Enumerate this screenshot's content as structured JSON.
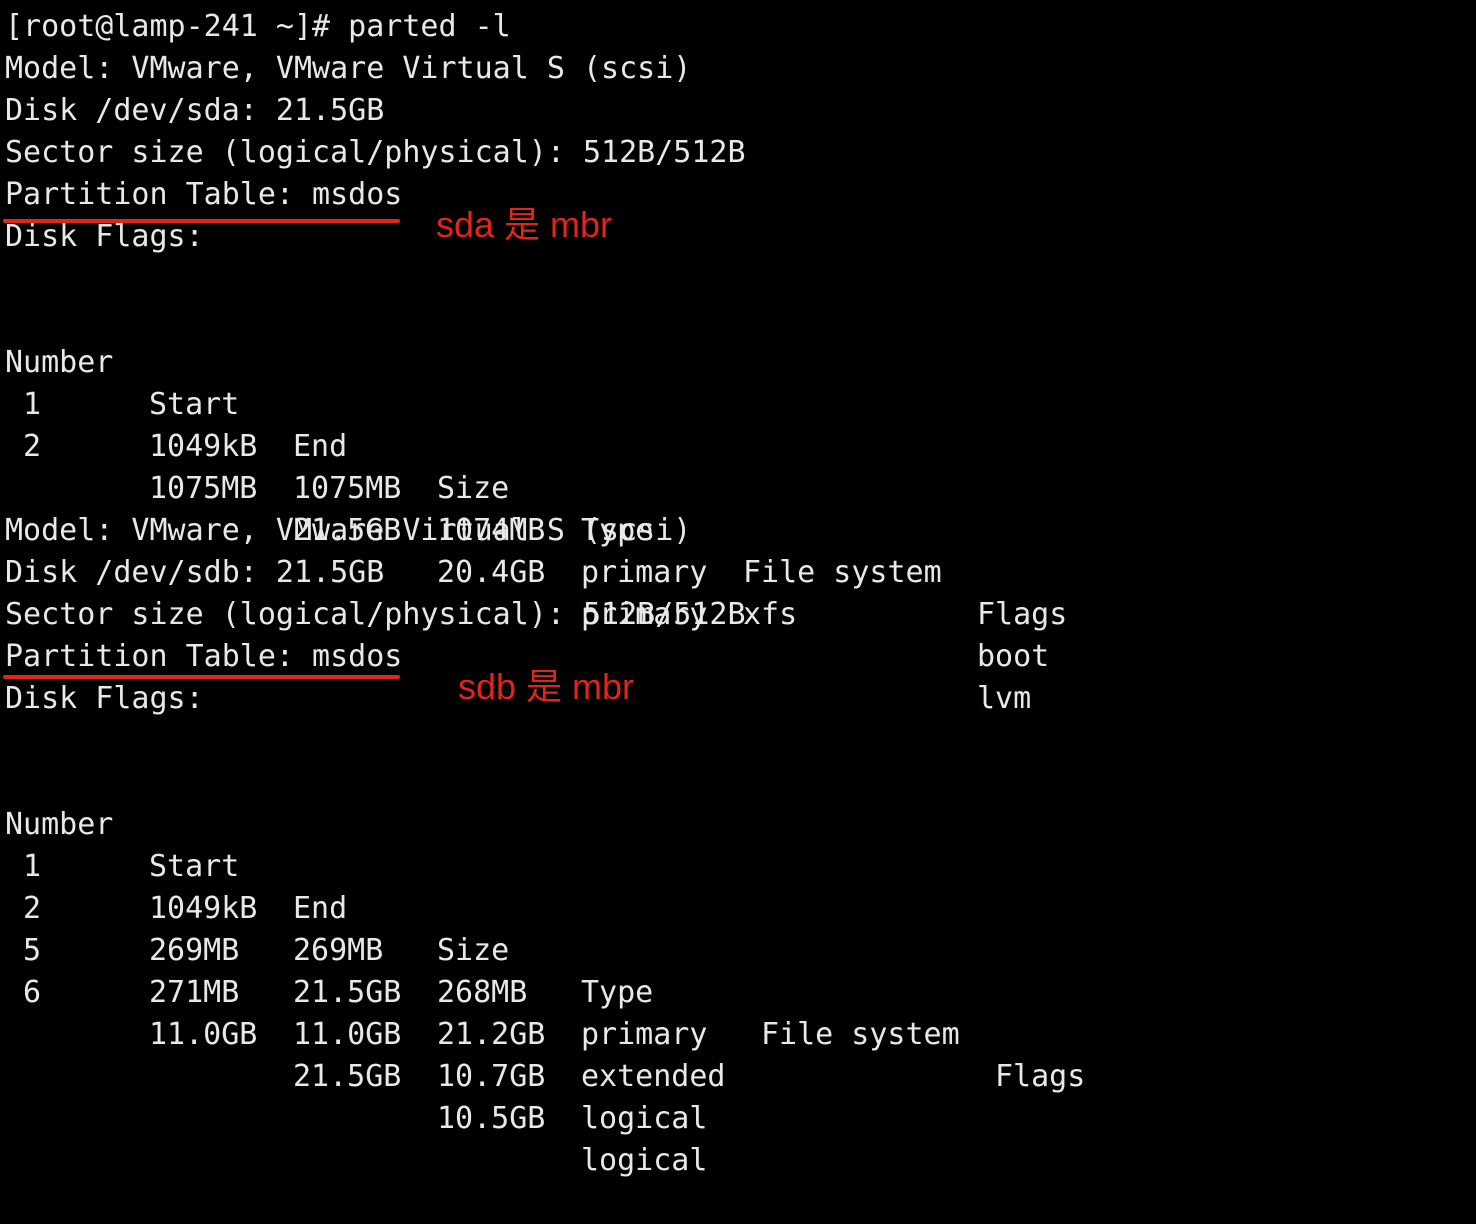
{
  "terminal": {
    "clipped_top_line": "[ ----- - - ----- - ]",
    "prompt": "[root@lamp-241 ~]# parted -l",
    "disks": [
      {
        "model": "Model: VMware, VMware Virtual S (scsi)",
        "disk": "Disk /dev/sda: 21.5GB",
        "sector_size": "Sector size (logical/physical): 512B/512B",
        "partition_table": "Partition Table: msdos",
        "disk_flags": "Disk Flags:",
        "annotation": "sda 是 mbr",
        "columns": [
          "Number",
          "Start",
          "End",
          "Size",
          "Type",
          "File system",
          "Flags"
        ],
        "rows": [
          [
            "1",
            "1049kB",
            "1075MB",
            "1074MB",
            "primary",
            "xfs",
            "boot"
          ],
          [
            "2",
            "1075MB",
            "21.5GB",
            "20.4GB",
            "primary",
            "",
            "lvm"
          ]
        ]
      },
      {
        "model": "Model: VMware, VMware Virtual S (scsi)",
        "disk": "Disk /dev/sdb: 21.5GB",
        "sector_size": "Sector size (logical/physical): 512B/512B",
        "partition_table": "Partition Table: msdos",
        "disk_flags": "Disk Flags:",
        "annotation": "sdb 是 mbr",
        "columns": [
          "Number",
          "Start",
          "End",
          "Size",
          "Type",
          "File system",
          "Flags"
        ],
        "rows": [
          [
            "1",
            "1049kB",
            "269MB",
            "268MB",
            "primary",
            "",
            ""
          ],
          [
            "2",
            "269MB",
            "21.5GB",
            "21.2GB",
            "extended",
            "",
            ""
          ],
          [
            "5",
            "271MB",
            "11.0GB",
            "10.7GB",
            "logical",
            "",
            ""
          ],
          [
            "6",
            "11.0GB",
            "21.5GB",
            "10.5GB",
            "logical",
            "",
            ""
          ]
        ]
      }
    ]
  },
  "colors": {
    "background": "#000000",
    "text": "#e8e8e8",
    "annotation": "#e0261c"
  }
}
